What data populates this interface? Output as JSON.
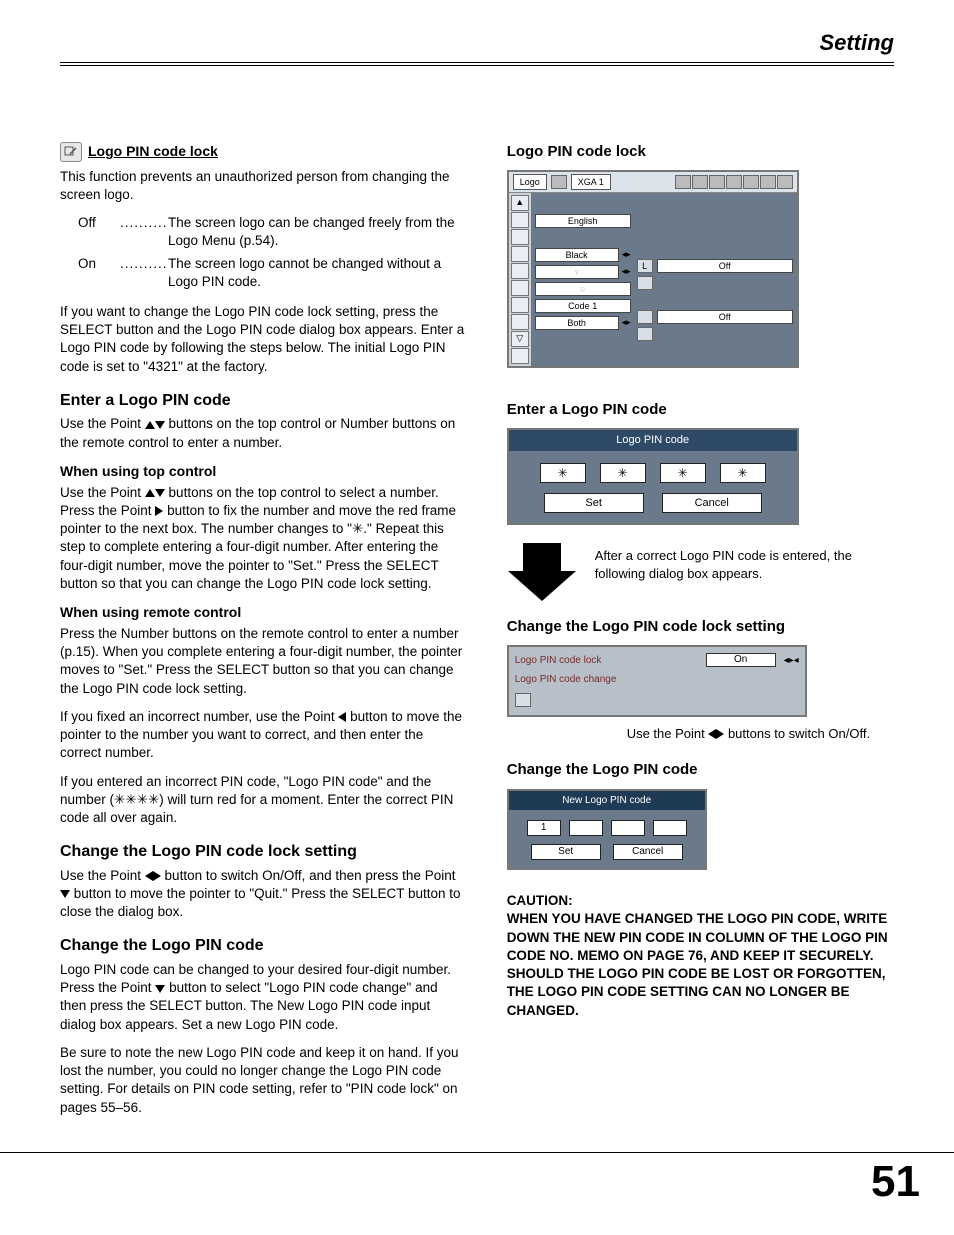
{
  "header": {
    "title": "Setting"
  },
  "page_number": "51",
  "left": {
    "section_icon_title": "Logo PIN code lock",
    "intro": "This function prevents an unauthorized person from changing the screen logo.",
    "defs": [
      {
        "key": "Off",
        "val": "The screen logo can be changed freely from the Logo Menu (p.54)."
      },
      {
        "key": "On",
        "val": "The screen logo cannot be changed without a Logo PIN code."
      }
    ],
    "para_after_defs": "If you want to change the Logo PIN code lock setting, press the SELECT button and the Logo PIN code dialog box appears. Enter a Logo PIN code by following the steps below. The initial Logo PIN code is set to \"4321\" at the factory.",
    "h_enter": "Enter a Logo PIN code",
    "enter_p1a": "Use the Point ",
    "enter_p1b": " buttons on the top control or Number buttons on the remote control to enter a number.",
    "h_top": "When using top control",
    "top_p_a": "Use the Point ",
    "top_p_b": " buttons on the top control to select a number. Press the Point ",
    "top_p_c": " button to fix the number and move the red frame pointer to the next box. The number changes to \"✳.\" Repeat this step to complete entering a four-digit number. After entering the four-digit number, move the pointer to \"Set.\" Press the SELECT button so that you can change the Logo PIN code lock setting.",
    "h_remote": "When using remote control",
    "remote_p": "Press the Number buttons on the remote control to enter a number (p.15). When you complete entering a four-digit number, the pointer moves to \"Set.\" Press the SELECT button so that you can change the Logo PIN code lock setting.",
    "fix_a": "If you fixed an incorrect number, use the Point ",
    "fix_b": " button to move the pointer to the number you want to correct, and then enter the correct number.",
    "wrong_p": "If you entered an incorrect PIN code, \"Logo PIN code\" and the number (✳✳✳✳) will turn red for a moment. Enter the correct PIN code all over again.",
    "h_change_lock": "Change the Logo PIN code lock setting",
    "change_lock_a": "Use the Point ",
    "change_lock_b": " button to switch On/Off, and then press the Point ",
    "change_lock_c": " button to move the pointer to \"Quit.\" Press the SELECT button to close the dialog box.",
    "h_change_pin": "Change the Logo PIN code",
    "change_pin_p1_a": "Logo PIN code can be changed to your desired four-digit number. Press the Point ",
    "change_pin_p1_b": " button to select \"Logo PIN code change\" and then press the SELECT button. The New Logo PIN code input dialog box appears. Set a new Logo PIN code.",
    "change_pin_p2": "Be sure to note the new Logo PIN code and keep it on hand. If you lost the number, you could no longer change the Logo PIN code setting. For details on PIN code setting, refer to \"PIN code lock\" on pages 55–56."
  },
  "right": {
    "fig1_title": "Logo PIN code lock",
    "osd": {
      "header_logo": "Logo",
      "header_mode": "XGA 1",
      "rows": [
        "English",
        "Black",
        "",
        "",
        "Code 1",
        "Both"
      ],
      "bars": [
        {
          "icon": "L",
          "label": "Off"
        },
        {
          "icon": "",
          "label": ""
        },
        {
          "icon": "",
          "label": "Off"
        },
        {
          "icon": "",
          "label": ""
        }
      ]
    },
    "fig2_title": "Enter a Logo PIN code",
    "pin_dialog": {
      "title": "Logo PIN code",
      "slots": [
        "✳",
        "✳",
        "✳",
        "✳"
      ],
      "set": "Set",
      "cancel": "Cancel"
    },
    "arrow_text": "After a correct Logo PIN code is entered, the following dialog box appears.",
    "fig3_title": "Change the Logo PIN code lock setting",
    "lock_box": {
      "row1_label": "Logo PIN code lock",
      "row1_val": "On",
      "row2_label": "Logo PIN code change"
    },
    "note_under_a": "Use the Point ",
    "note_under_b": " buttons to switch On/Off.",
    "fig4_title": "Change the Logo PIN code",
    "new_pin": {
      "title": "New Logo PIN code",
      "slots": [
        "1",
        "",
        "",
        ""
      ],
      "set": "Set",
      "cancel": "Cancel"
    },
    "caution_label": "CAUTION:",
    "caution_body": "WHEN YOU HAVE CHANGED THE LOGO PIN CODE, WRITE DOWN THE NEW PIN CODE IN COLUMN OF THE LOGO PIN CODE NO. MEMO ON PAGE 76, AND KEEP IT SECURELY. SHOULD THE LOGO PIN CODE BE LOST OR FORGOTTEN, THE LOGO PIN CODE SETTING CAN NO LONGER BE CHANGED."
  }
}
